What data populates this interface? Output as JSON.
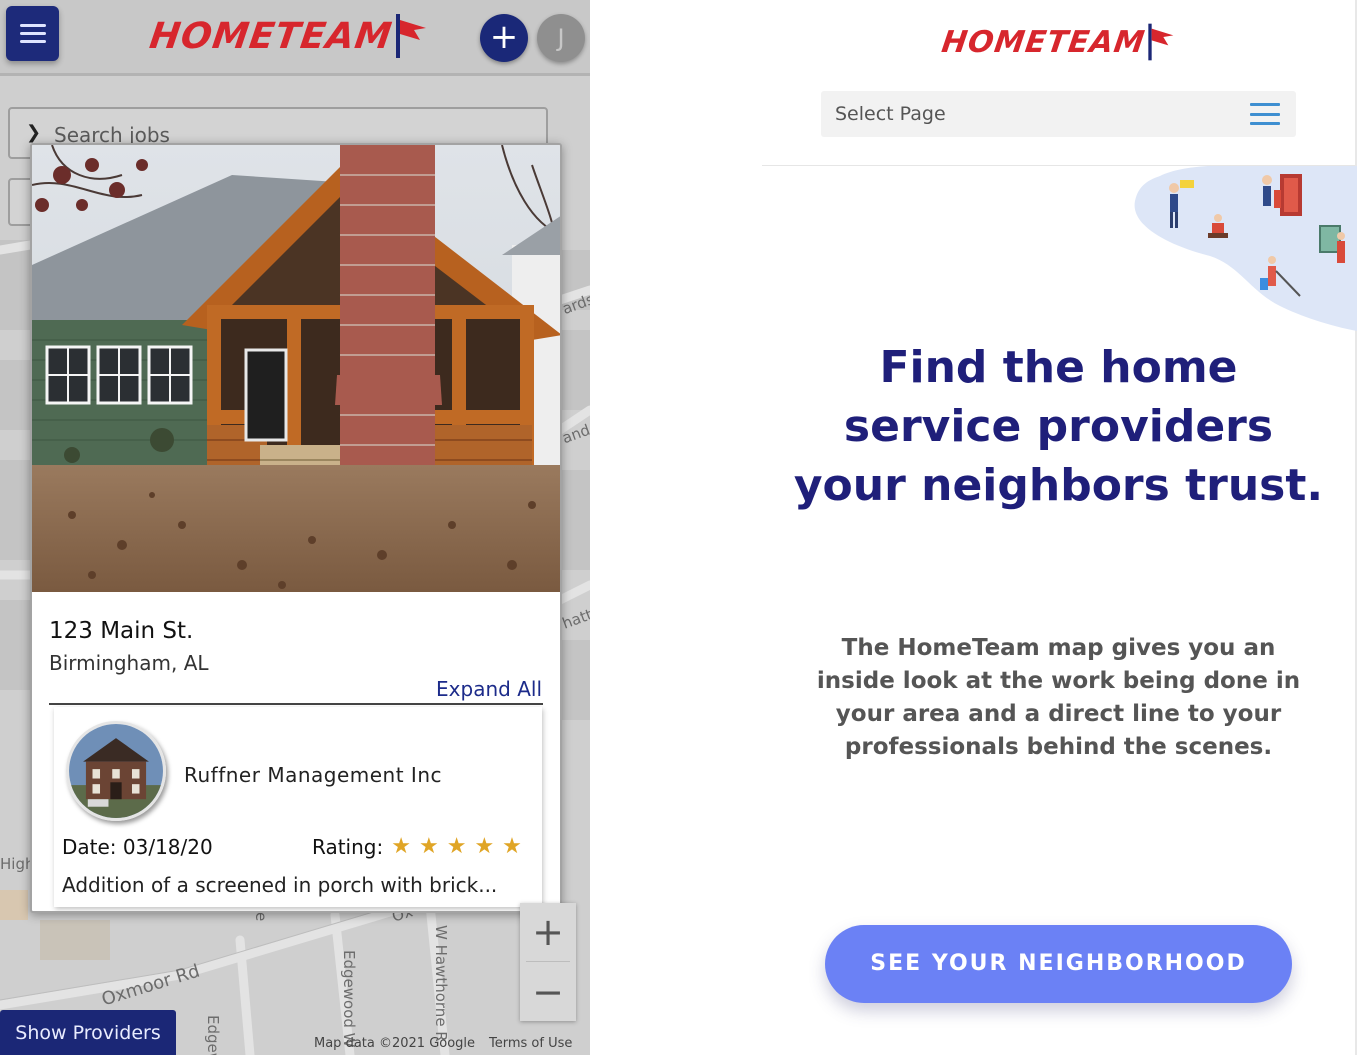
{
  "left_app": {
    "brand": "HOMETEAM",
    "header": {
      "menu_icon": "hamburger-menu-icon",
      "add_label": "+",
      "avatar_initial": "J"
    },
    "search": {
      "placeholder": "Search jobs",
      "chevron_icon": "chevron-down-icon"
    },
    "job_card": {
      "address_line1": "123 Main St.",
      "address_line2": "Birmingham, AL",
      "expand_label": "Expand All",
      "provider": {
        "name": "Ruffner Management Inc",
        "date_label": "Date: 03/18/20",
        "rating_label": "Rating:",
        "rating_stars": 5,
        "description": "Addition of a screened in porch with brick..."
      }
    },
    "map": {
      "streets": [
        "Oxmoor Rd",
        "Edgewood",
        "Edgewood W",
        "W Hawthorne R",
        "High",
        "ards",
        "and",
        "hatt",
        "Ox",
        "e"
      ],
      "zoom_in_label": "+",
      "zoom_out_label": "−",
      "attribution": "Map data ©2021 Google",
      "terms_label": "Terms of Use"
    },
    "show_providers_label": "Show Providers",
    "colors": {
      "navy": "#1b2776",
      "brand_red": "#d7262d",
      "star": "#e0a526"
    }
  },
  "right_site": {
    "brand": "HOMETEAM",
    "select_page_label": "Select Page",
    "menu_icon": "hamburger-menu-icon",
    "hero_title": "Find the home service providers your neighbors trust.",
    "hero_description": "The HomeTeam map gives you an inside look at the work being done in your area and a direct line to your professionals behind the scenes.",
    "cta_label": "SEE YOUR NEIGHBORHOOD",
    "colors": {
      "title": "#1f1f7a",
      "cta": "#6b81f5",
      "menu": "#3e8fd1"
    }
  }
}
